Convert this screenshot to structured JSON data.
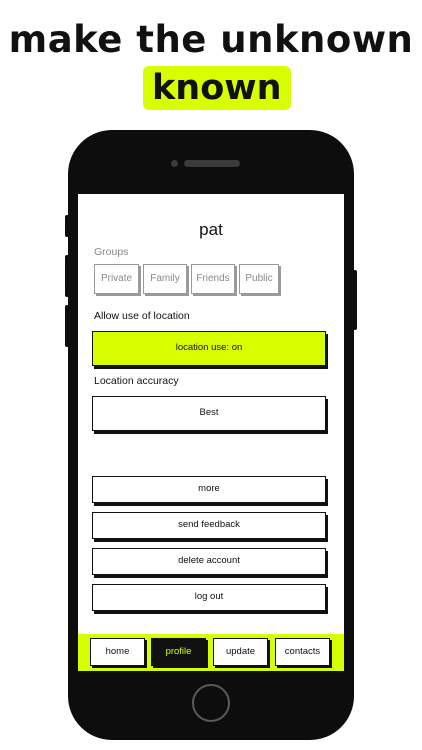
{
  "headline": {
    "line1": "make the unknown",
    "line2": "known"
  },
  "profile": {
    "username": "pat",
    "groups_label": "Groups",
    "groups": [
      "Private",
      "Family",
      "Friends",
      "Public"
    ],
    "location_label": "Allow use of location",
    "location_button": "location use: on",
    "accuracy_label": "Location accuracy",
    "accuracy_button": "Best",
    "actions": [
      "more",
      "send feedback",
      "delete account",
      "log out"
    ]
  },
  "tabs": [
    {
      "label": "home",
      "active": false
    },
    {
      "label": "profile",
      "active": true
    },
    {
      "label": "update",
      "active": false
    },
    {
      "label": "contacts",
      "active": false
    }
  ],
  "colors": {
    "accent": "#d8ff00",
    "phone_body": "#0d0d0d",
    "text": "#111111",
    "muted": "#8a8a8a"
  }
}
